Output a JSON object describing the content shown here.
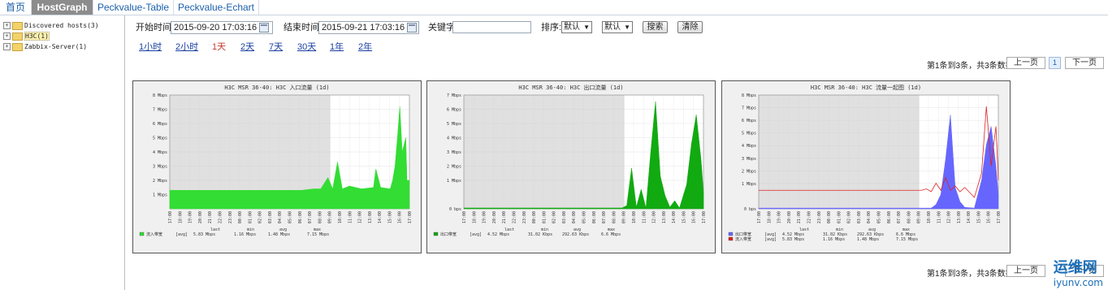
{
  "tabs": [
    {
      "label": "首页"
    },
    {
      "label": "HostGraph"
    },
    {
      "label": "Peckvalue-Table"
    },
    {
      "label": "Peckvalue-Echart"
    }
  ],
  "sidebar": {
    "items": [
      {
        "label": "Discovered hosts(3)"
      },
      {
        "label": "H3C(1)"
      },
      {
        "label": "Zabbix-Server(1)"
      }
    ]
  },
  "filters": {
    "start_label": "开始时间:",
    "start_value": "2015-09-20 17:03:16",
    "end_label": "结束时间:",
    "end_value": "2015-09-21 17:03:16",
    "keyword_label": "关键字:",
    "keyword_value": "",
    "sort_label": "排序:",
    "sort1": "默认",
    "sort2": "默认",
    "search_button": "搜索",
    "clear_button": "清除"
  },
  "time_links": [
    "1小时",
    "2小时",
    "1天",
    "2天",
    "7天",
    "30天",
    "1年",
    "2年"
  ],
  "pager": {
    "info": "第1条到3条，共3条数据",
    "prev": "上一页",
    "page": "1",
    "next": "下一页"
  },
  "colors": {
    "green_fill": "#33dd33",
    "dark_green_fill": "#11aa11",
    "blue_fill": "#6666ff",
    "red_line": "#dd2222",
    "tab_active_bg": "#8c8c8c"
  },
  "graphs": [
    {
      "title": "H3C MSR 36-40: H3C 入口流量 (1d)",
      "y_ticks": [
        "1 Mbps",
        "2 Mbps",
        "3 Mbps",
        "4 Mbps",
        "5 Mbps",
        "6 Mbps",
        "7 Mbps",
        "8 Mbps"
      ],
      "x_ticks": [
        "17:00",
        "18:00",
        "19:00",
        "20:00",
        "21:00",
        "22:00",
        "23:00",
        "00:00",
        "01:00",
        "02:00",
        "03:00",
        "04:00",
        "05:00",
        "06:00",
        "07:00",
        "08:00",
        "09:00",
        "10:00",
        "11:00",
        "12:00",
        "13:00",
        "14:00",
        "15:00",
        "16:00",
        "17:00"
      ],
      "legend": [
        {
          "name": "流入带宽",
          "avg_tag": "[avg]",
          "last": "5.83 Mbps",
          "min": "1.16 Mbps",
          "avg": "1.48 Mbps",
          "max": "7.15 Mbps",
          "color": "#33dd33"
        }
      ]
    },
    {
      "title": "H3C MSR 36-40: H3C 出口流量 (1d)",
      "y_ticks": [
        "0 bps",
        "1 Mbps",
        "2 Mbps",
        "3 Mbps",
        "4 Mbps",
        "5 Mbps",
        "6 Mbps",
        "7 Mbps"
      ],
      "x_ticks": [
        "17:00",
        "18:00",
        "19:00",
        "20:00",
        "21:00",
        "22:00",
        "23:00",
        "00:00",
        "01:00",
        "02:00",
        "03:00",
        "04:00",
        "05:00",
        "06:00",
        "07:00",
        "08:00",
        "09:00",
        "10:00",
        "11:00",
        "12:00",
        "13:00",
        "14:00",
        "15:00",
        "16:00",
        "17:00"
      ],
      "legend": [
        {
          "name": "出口带宽",
          "avg_tag": "[avg]",
          "last": "4.52 Mbps",
          "min": "31.02 Kbps",
          "avg": "292.63 Kbps",
          "max": "6.6 Mbps",
          "color": "#11aa11"
        }
      ]
    },
    {
      "title": "H3C MSR 36-40: H3C 流量一起图 (1d)",
      "y_ticks": [
        "0 bps",
        "1 Mbps",
        "2 Mbps",
        "3 Mbps",
        "4 Mbps",
        "5 Mbps",
        "6 Mbps",
        "7 Mbps",
        "8 Mbps"
      ],
      "x_ticks": [
        "17:00",
        "18:00",
        "19:00",
        "20:00",
        "21:00",
        "22:00",
        "23:00",
        "00:00",
        "01:00",
        "02:00",
        "03:00",
        "04:00",
        "05:00",
        "06:00",
        "07:00",
        "08:00",
        "09:00",
        "10:00",
        "11:00",
        "12:00",
        "13:00",
        "14:00",
        "15:00",
        "16:00",
        "17:00"
      ],
      "legend": [
        {
          "name": "出口带宽",
          "avg_tag": "[avg]",
          "last": "4.52 Mbps",
          "min": "31.02 Kbps",
          "avg": "292.63 Kbps",
          "max": "6.6 Mbps",
          "color": "#6666ff"
        },
        {
          "name": "流入带宽",
          "avg_tag": "[avg]",
          "last": "5.83 Mbps",
          "min": "1.16 Mbps",
          "avg": "1.48 Mbps",
          "max": "7.15 Mbps",
          "color": "#dd2222"
        }
      ]
    }
  ],
  "legend_headers": {
    "last": "last",
    "min": "min",
    "avg": "avg",
    "max": "max"
  },
  "watermark": {
    "main": "运维网",
    "sub": "iyunv.com"
  }
}
